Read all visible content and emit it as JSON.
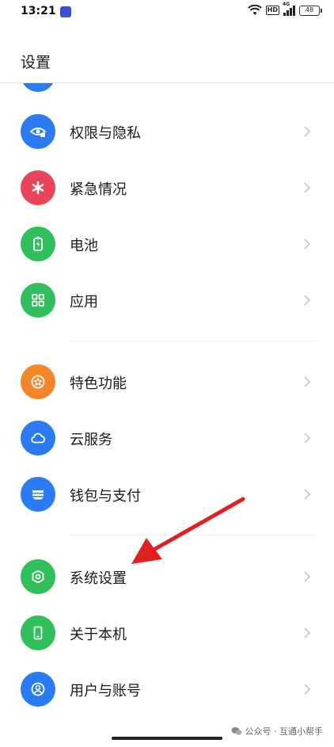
{
  "status_bar": {
    "time": "13:21",
    "hd": "HD",
    "network": "4G",
    "battery": "48"
  },
  "page": {
    "title": "设置"
  },
  "menu": {
    "items": [
      {
        "id": "privacy",
        "label": "权限与隐私",
        "icon": "eye-lock-icon",
        "color": "#2b7cf3"
      },
      {
        "id": "emergency",
        "label": "紧急情况",
        "icon": "asterisk-icon",
        "color": "#e8455a"
      },
      {
        "id": "battery",
        "label": "电池",
        "icon": "battery-icon",
        "color": "#2fbf5b"
      },
      {
        "id": "apps",
        "label": "应用",
        "icon": "grid-icon",
        "color": "#2fbf5b"
      },
      {
        "id": "features",
        "label": "特色功能",
        "icon": "star-icon",
        "color": "#f5852a"
      },
      {
        "id": "cloud",
        "label": "云服务",
        "icon": "cloud-icon",
        "color": "#2b7cf3"
      },
      {
        "id": "wallet",
        "label": "钱包与支付",
        "icon": "wallet-icon",
        "color": "#2b7cf3"
      },
      {
        "id": "system",
        "label": "系统设置",
        "icon": "hexagon-icon",
        "color": "#2fbf5b"
      },
      {
        "id": "about",
        "label": "关于本机",
        "icon": "phone-icon",
        "color": "#2fbf5b"
      },
      {
        "id": "account",
        "label": "用户与账号",
        "icon": "user-icon",
        "color": "#2b7cf3"
      }
    ]
  },
  "annotation": {
    "arrow_color": "#e02020"
  },
  "watermark": {
    "text": "公众号 · 互通小帮手"
  }
}
